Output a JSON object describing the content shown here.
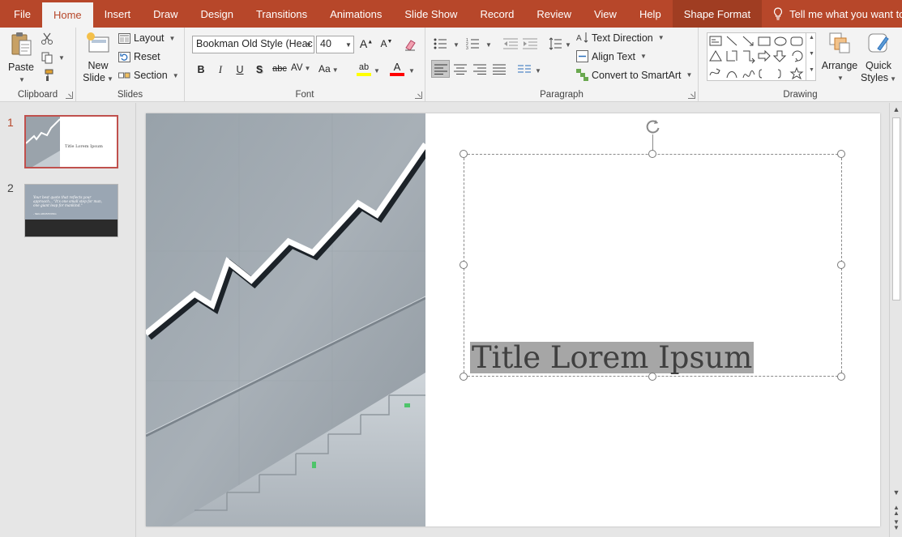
{
  "tabs": {
    "file": "File",
    "home": "Home",
    "insert": "Insert",
    "draw": "Draw",
    "design": "Design",
    "transitions": "Transitions",
    "animations": "Animations",
    "slideshow": "Slide Show",
    "record": "Record",
    "review": "Review",
    "view": "View",
    "help": "Help",
    "shape_format": "Shape Format",
    "tell_me": "Tell me what you want to do"
  },
  "ribbon": {
    "clipboard": {
      "label": "Clipboard",
      "paste": "Paste"
    },
    "slides": {
      "label": "Slides",
      "new_slide_1": "New",
      "new_slide_2": "Slide",
      "layout": "Layout",
      "reset": "Reset",
      "section": "Section"
    },
    "font": {
      "label": "Font",
      "font_name": "Bookman Old Style (Heac",
      "font_size": "40",
      "bold": "B",
      "italic": "I",
      "underline": "U",
      "shadow": "S",
      "strike": "abc",
      "spacing": "AV",
      "case": "Aa",
      "highlight": "ab",
      "color": "A"
    },
    "paragraph": {
      "label": "Paragraph",
      "text_direction": "Text Direction",
      "align_text": "Align Text",
      "convert_smartart": "Convert to SmartArt"
    },
    "drawing": {
      "label": "Drawing",
      "arrange": "Arrange",
      "quick_1": "Quick",
      "quick_2": "Styles"
    }
  },
  "colors": {
    "accent": "#b7472a",
    "highlight_yellow": "#ffff00",
    "font_red": "#ff0000"
  },
  "thumbnails": [
    {
      "number": "1",
      "title": "Title Lorem Ipsum",
      "selected": true
    },
    {
      "number": "2",
      "quote": "Your best quote that reflects your approach... \"It's one small step for man, one giant leap for mankind.\"",
      "author": "- NEIL ARMSTRONG",
      "selected": false
    }
  ],
  "slide": {
    "title": "Title Lorem Ipsum"
  }
}
